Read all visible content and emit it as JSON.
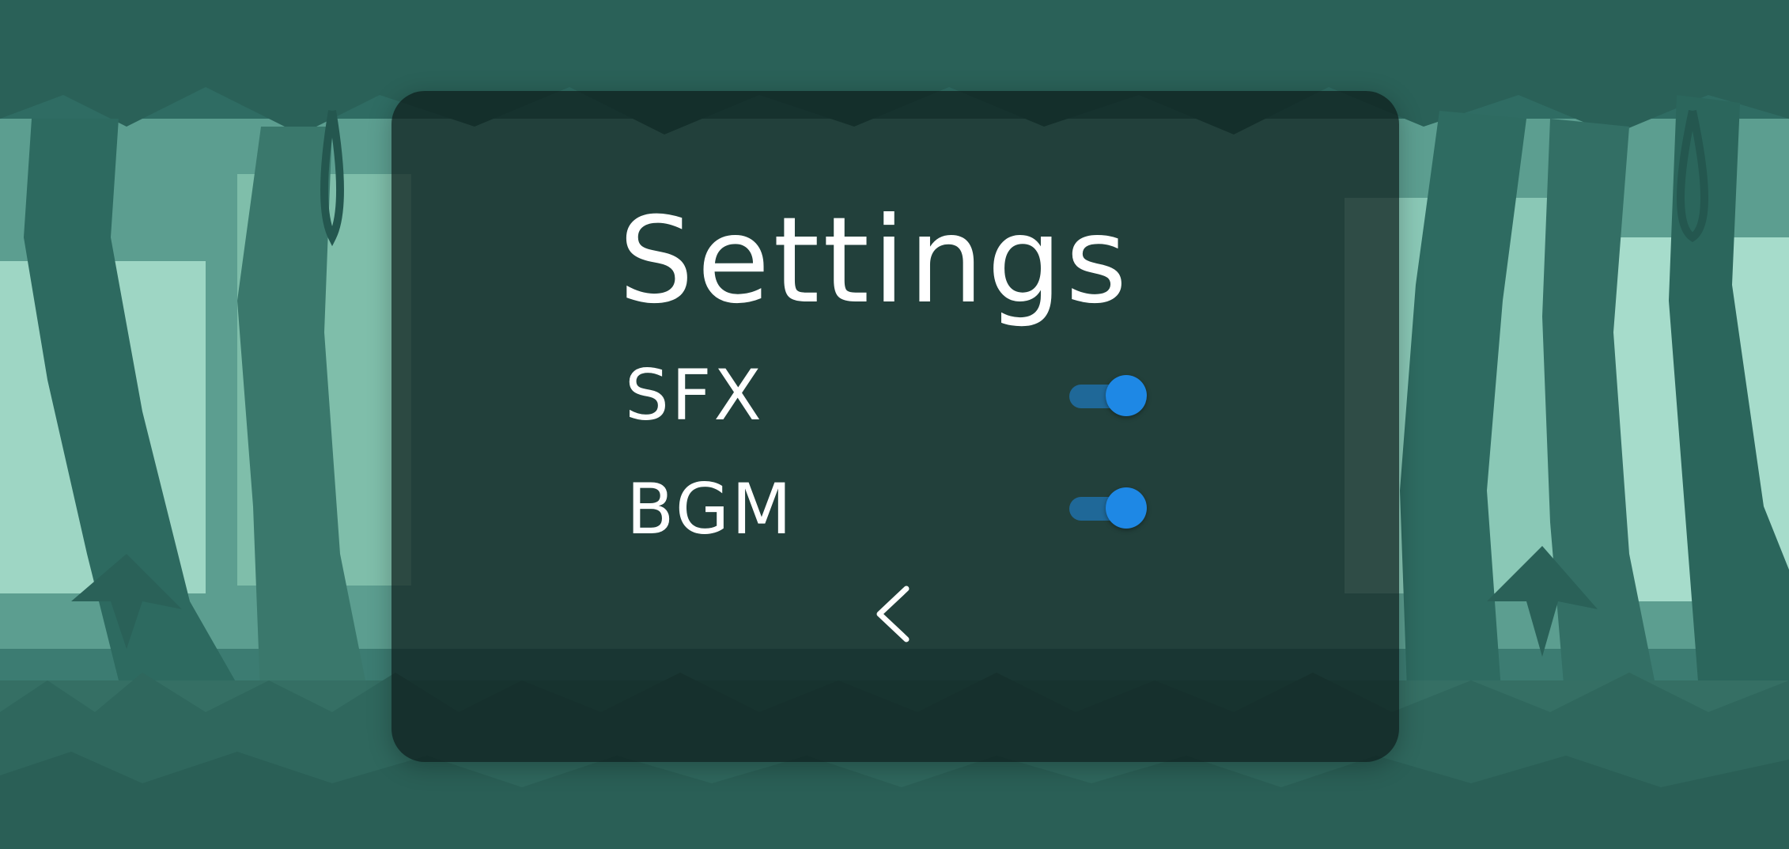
{
  "screen": {
    "title": "Settings"
  },
  "settings": [
    {
      "id": "sfx",
      "label": "SFX",
      "enabled": true
    },
    {
      "id": "bgm",
      "label": "BGM",
      "enabled": true
    }
  ],
  "back": {
    "icon": "chevron-left-icon"
  },
  "colors": {
    "toggle_accent": "#1e88e5",
    "text": "#ffffff",
    "panel": "#0c1c1a"
  }
}
